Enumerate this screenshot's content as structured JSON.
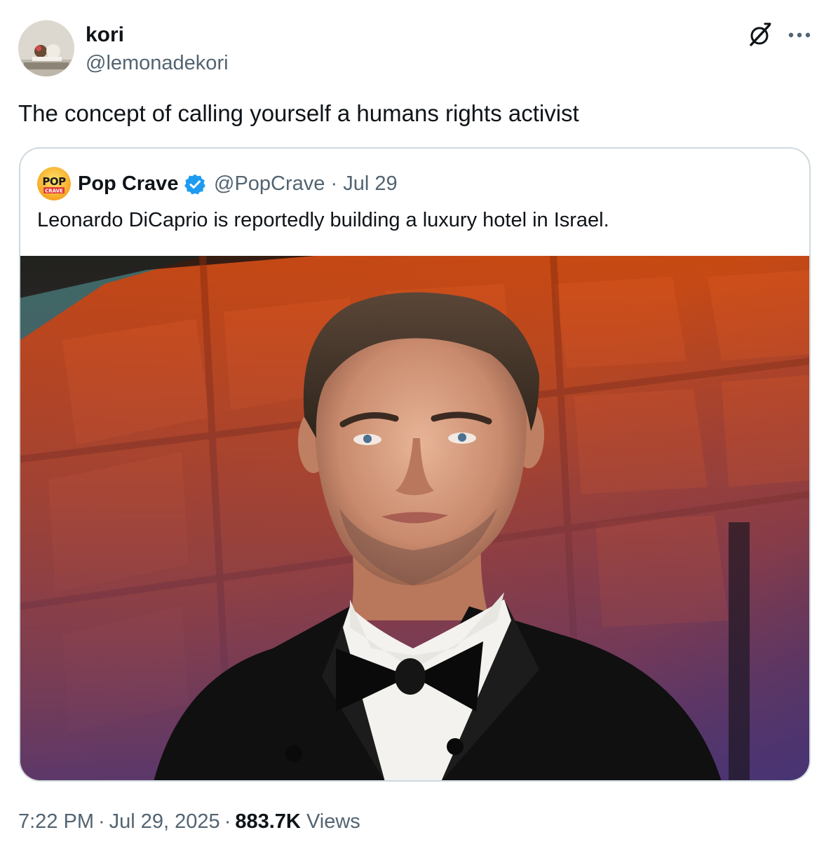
{
  "tweet": {
    "author": {
      "name": "kori",
      "handle": "@lemonadekori"
    },
    "text": "The concept of calling yourself a humans rights activist",
    "quoted": {
      "author_name": "Pop Crave",
      "author_handle": "@PopCrave",
      "date_sep": "·",
      "date": "Jul 29",
      "avatar_text_top": "POP",
      "avatar_text_bottom": "CRAVE",
      "text": "Leonardo DiCaprio is reportedly building a luxury hotel in Israel."
    },
    "footer": {
      "time": "7:22 PM",
      "sep1": "·",
      "date": "Jul 29, 2025",
      "sep2": "·",
      "views_count": "883.7K",
      "views_label": "Views"
    }
  },
  "icons": {
    "grok": "grok-icon",
    "more": "more-dots-icon",
    "verified": "verified-badge-icon"
  },
  "colors": {
    "text_primary": "#0f1419",
    "text_secondary": "#536471",
    "border": "#cfd9de",
    "verified_blue": "#1d9bf0"
  }
}
